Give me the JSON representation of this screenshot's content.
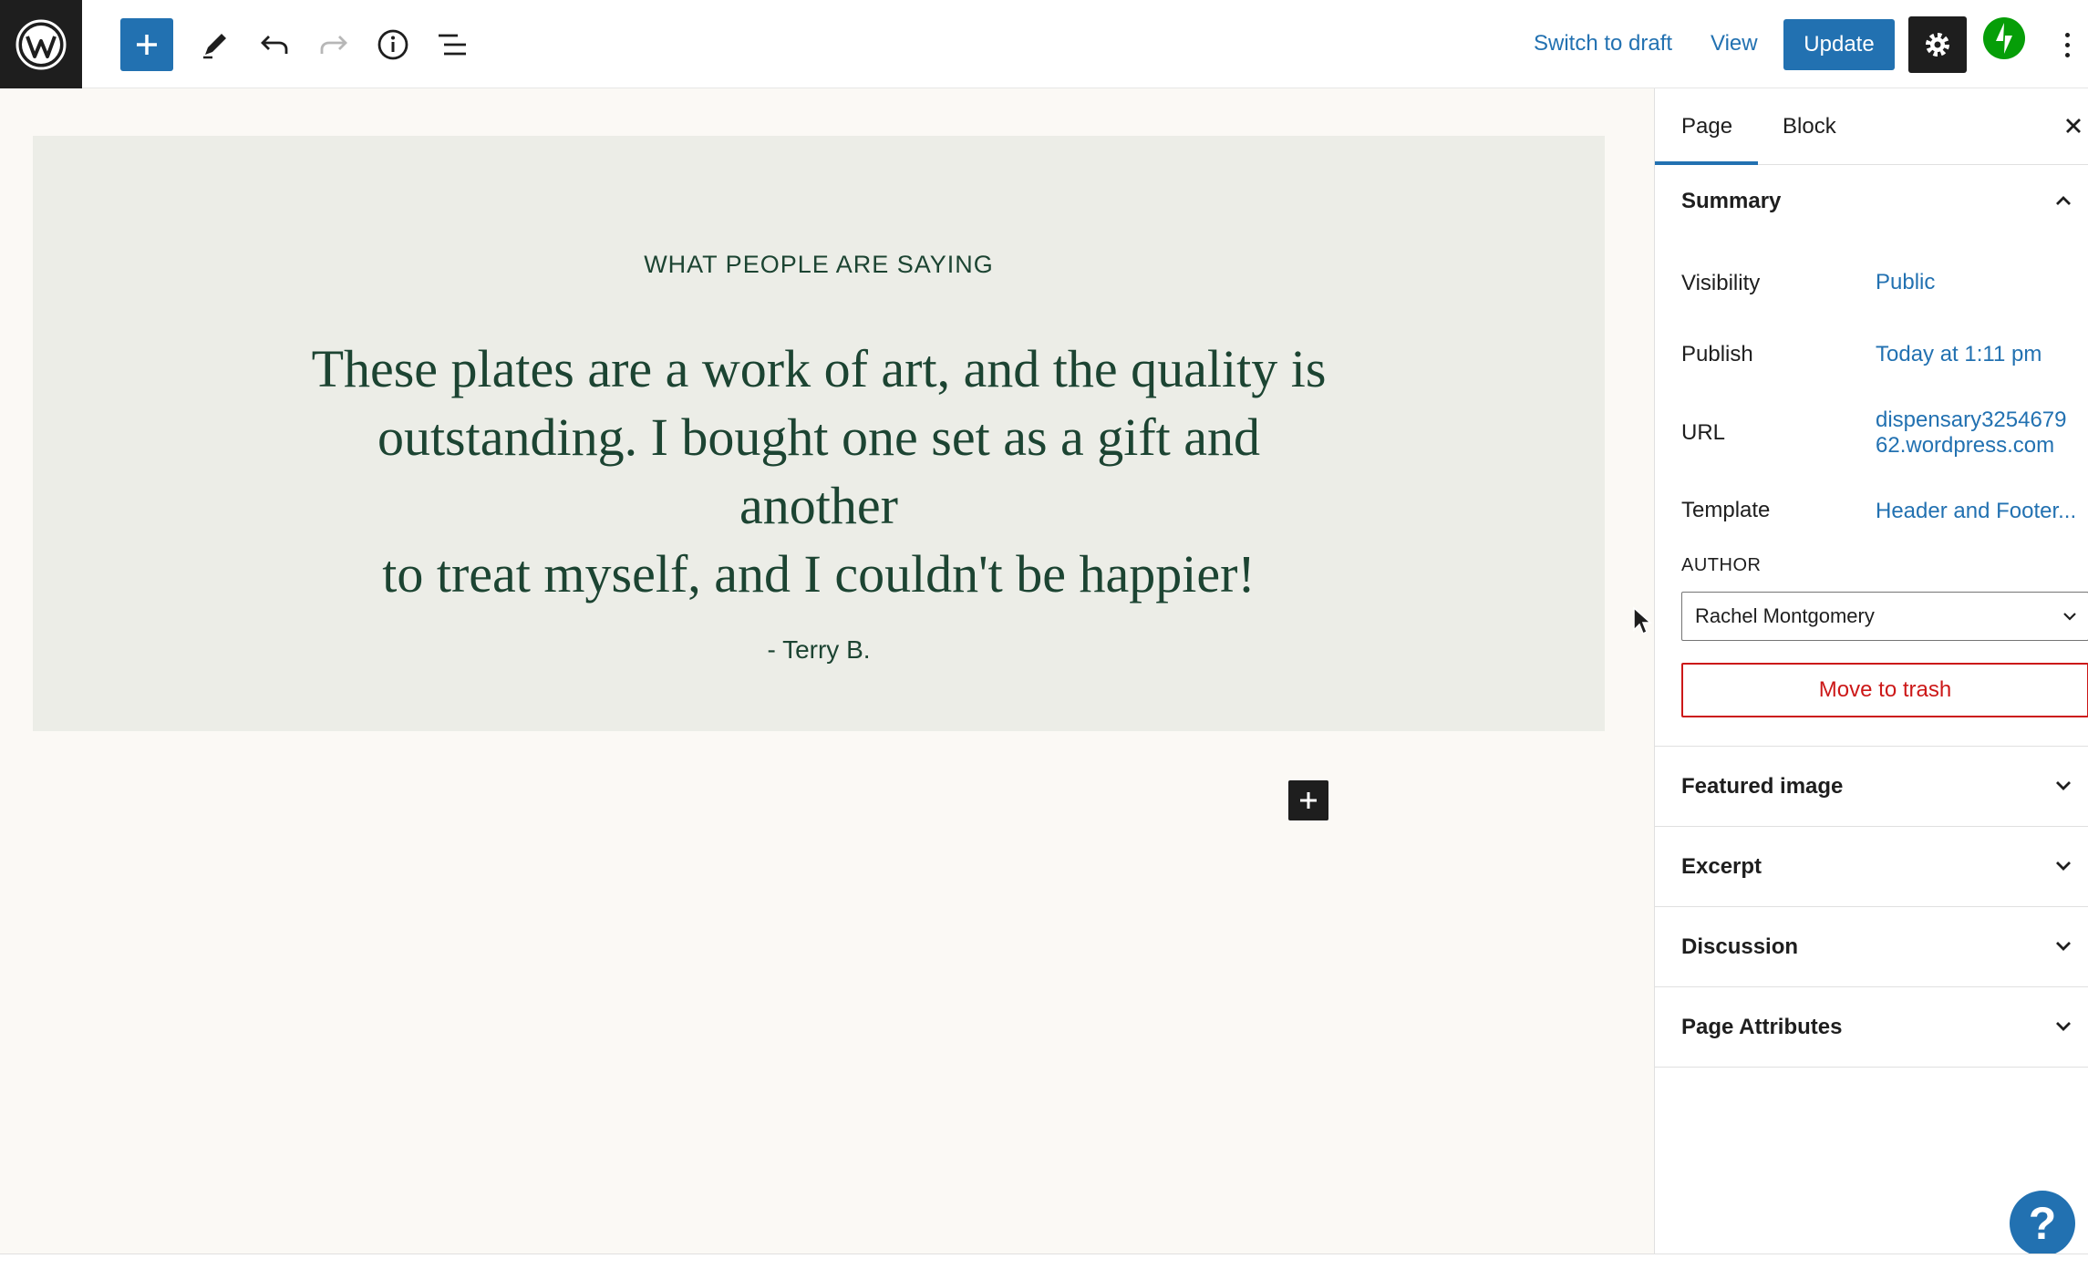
{
  "toolbar": {
    "logo": "wordpress-logo",
    "add_icon": "plus-icon",
    "edit_icon": "pencil-icon",
    "undo_icon": "undo-icon",
    "redo_icon": "redo-icon",
    "info_icon": "info-icon",
    "list_view_icon": "list-view-icon",
    "switch_to_draft": "Switch to draft",
    "view": "View",
    "update": "Update",
    "settings_icon": "gear-icon",
    "jetpack_icon": "jetpack-bolt-icon",
    "more_icon": "more-vertical-icon"
  },
  "content": {
    "eyebrow": "WHAT PEOPLE ARE SAYING",
    "quote_lines": [
      "These plates are a work of art, and the quality is",
      "outstanding. I bought one set as a gift and another",
      "to treat myself, and I couldn't be happier!"
    ],
    "author": "- Terry B."
  },
  "sidebar": {
    "tabs": [
      "Page",
      "Block"
    ],
    "active_tab": "Page",
    "summary": {
      "title": "Summary",
      "rows": [
        {
          "label": "Visibility",
          "value": "Public"
        },
        {
          "label": "Publish",
          "value": "Today at 1:11 pm"
        },
        {
          "label": "URL",
          "value_lines": [
            "dispensary3254679",
            "62.wordpress.com"
          ]
        },
        {
          "label": "Template",
          "value": "Header and Footer..."
        }
      ],
      "author_label": "AUTHOR",
      "author_value": "Rachel Montgomery",
      "trash": "Move to trash"
    },
    "panels": [
      "Featured image",
      "Excerpt",
      "Discussion",
      "Page Attributes"
    ]
  },
  "help": "?",
  "colors": {
    "accent": "#2271b1",
    "dark": "#1e1e1e",
    "danger": "#cc1818",
    "quote_text": "#1c4432",
    "quote_bg": "#ecede7",
    "canvas_bg": "#fbf9f5",
    "jetpack": "#069e08"
  }
}
